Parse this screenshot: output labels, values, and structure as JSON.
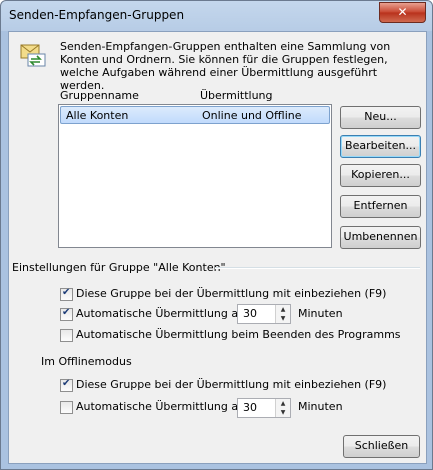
{
  "window": {
    "title": "Senden-Empfangen-Gruppen",
    "close_glyph": "✕"
  },
  "intro": {
    "text": "Senden-Empfangen-Gruppen enthalten eine Sammlung von Konten und Ordnern. Sie können für die Gruppen festlegen, welche Aufgaben während einer Übermittlung ausgeführt werden."
  },
  "list": {
    "headers": {
      "name": "Gruppenname",
      "transfer": "Übermittlung"
    },
    "rows": [
      {
        "name": "Alle Konten",
        "transfer": "Online und Offline"
      }
    ]
  },
  "buttons": {
    "new": "Neu...",
    "edit": "Bearbeiten...",
    "copy": "Kopieren...",
    "remove": "Entfernen",
    "rename": "Umbenennen",
    "close": "Schließen"
  },
  "settings": {
    "heading": "Einstellungen für Gruppe \"Alle Konten\"",
    "include": {
      "label": "Diese Gruppe bei der Übermittlung mit einbeziehen (F9)",
      "checked": true
    },
    "auto": {
      "label": "Automatische Übermittlung alle",
      "checked": true,
      "minutes": "30",
      "unit": "Minuten"
    },
    "on_exit": {
      "label": "Automatische Übermittlung beim Beenden des Programms",
      "checked": false
    }
  },
  "offline": {
    "heading": "Im Offlinemodus",
    "include": {
      "label": "Diese Gruppe bei der Übermittlung mit einbeziehen (F9)",
      "checked": true
    },
    "auto": {
      "label": "Automatische Übermittlung alle",
      "checked": false,
      "minutes": "30",
      "unit": "Minuten"
    }
  },
  "icons": {
    "header": "send-receive-icon"
  }
}
